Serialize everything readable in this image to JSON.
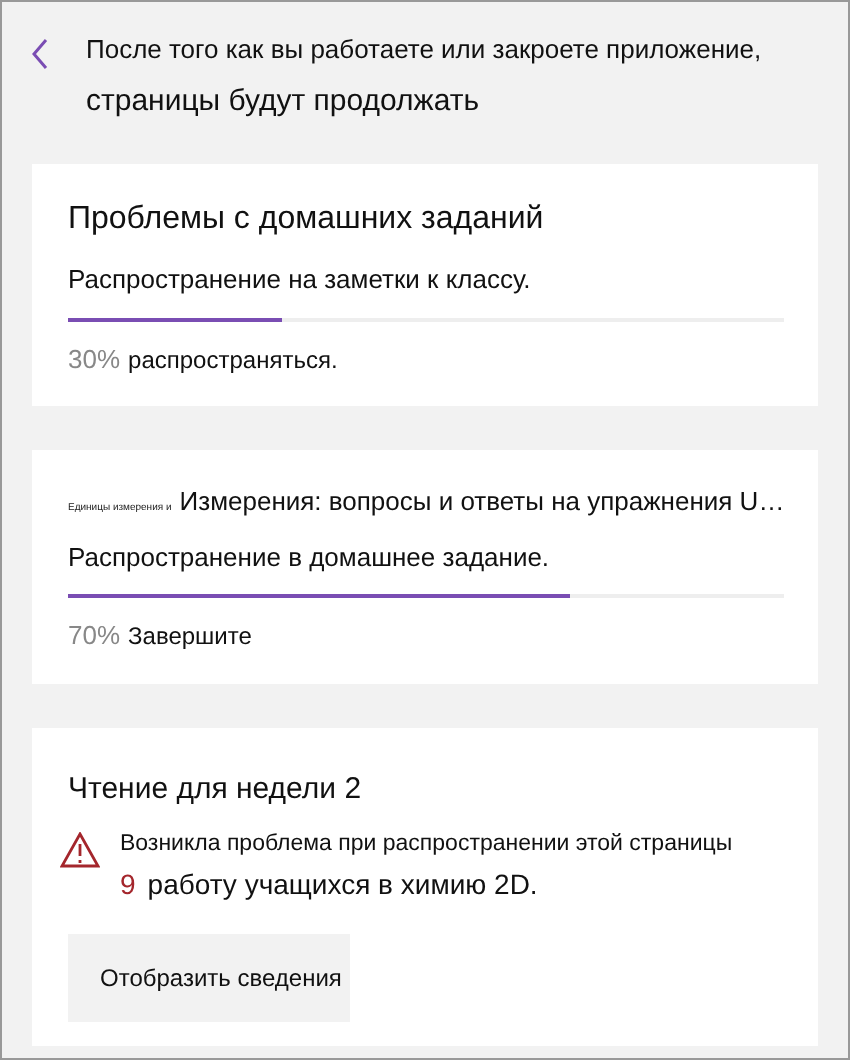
{
  "header": {
    "line_1": "После того как вы работаете или закроете приложение,",
    "line_2": "страницы будут продолжать"
  },
  "cards": [
    {
      "kind": "progress",
      "title": "Проблемы с домашних заданий",
      "status": "Распространение на заметки к классу.",
      "level": 0.3,
      "percent": "30%",
      "reading": "распространяться."
    },
    {
      "kind": "progress",
      "prefix": "Единицы измерения и",
      "title": "Измерения: вопросы и ответы на упражнения U…",
      "status": "Распространение в домашнее задание.",
      "level": 0.7,
      "percent": "70%",
      "reading": "Завершите"
    },
    {
      "kind": "error",
      "title": "Чтение для недели 2",
      "message": "Возникла проблема при распространении этой страницы",
      "count": "9",
      "message_rest": "работу учащихся в химию 2D.",
      "button": "Отобразить сведения"
    }
  ]
}
